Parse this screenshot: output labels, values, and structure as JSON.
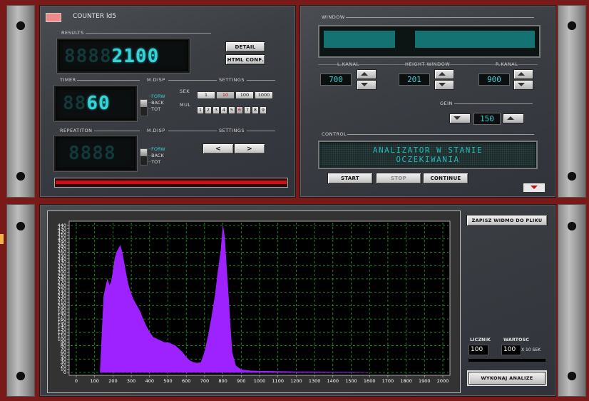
{
  "app": {
    "title": "COUNTER ld5"
  },
  "results": {
    "label": "RESULTS",
    "value": "2100",
    "ghost": "8888",
    "detail_label": "DETAIL",
    "html_label": "HTML CONF."
  },
  "timer": {
    "label": "TIMER",
    "value": "60",
    "ghost": "88",
    "mdisp_label": "M.DISP",
    "settings_label": "SETTINGS",
    "options": [
      "FORW",
      "BACK",
      "TOT"
    ],
    "sek_label": "SEK",
    "mul_label": "MUL",
    "sek_values": [
      "1",
      "10",
      "100",
      "1000"
    ],
    "sek_selected": "10",
    "mul_values": [
      "1",
      "2",
      "3",
      "4",
      "5",
      "6",
      "7",
      "8",
      "9"
    ],
    "mul_selected": "6"
  },
  "repetition": {
    "label": "REPEATITON",
    "ghost": "8888",
    "mdisp_label": "M.DISP",
    "settings_label": "SETTINGS",
    "options": [
      "FORW",
      "BACK",
      "TOT"
    ],
    "prev_label": "<",
    "next_label": ">"
  },
  "window": {
    "label": "WINDOW",
    "lkanal_label": "L.KANAL",
    "lkanal_value": "700",
    "height_label": "HEIGHT WINDOW",
    "height_value": "201",
    "rkanal_label": "R.KANAL",
    "rkanal_value": "900",
    "gein_label": "GEIN",
    "gein_value": "150"
  },
  "control": {
    "label": "CONTROL",
    "message_line1": "ANALIZATOR W STANIE",
    "message_line2": "OCZEKIWANIA",
    "start_label": "START",
    "stop_label": "STOP",
    "continue_label": "CONTINUE"
  },
  "spectrum_panel": {
    "save_label": "ZAPISZ WIDMO DO PLIKU",
    "licznik_label": "LICZNIK",
    "licznik_value": "100",
    "wartosc_label": "WARTOSC",
    "wartosc_value": "100",
    "wartosc_unit": "X 10 SEK",
    "analyze_label": "WYKONAJ ANALIZE"
  },
  "colors": {
    "lcd": "#37d3d6",
    "spectrum": "#9d22ff",
    "grid": "#22aa22",
    "chassis": "#7a1a18"
  },
  "chart_data": {
    "type": "area",
    "xlim": [
      0,
      2000
    ],
    "ylim": [
      0,
      440
    ],
    "xticks": [
      0,
      100,
      200,
      300,
      400,
      500,
      600,
      700,
      800,
      900,
      1000,
      1100,
      1200,
      1300,
      1400,
      1500,
      1600,
      1700,
      1800,
      1900,
      2000
    ],
    "yticks": [
      0,
      10,
      20,
      30,
      40,
      50,
      60,
      70,
      80,
      90,
      100,
      110,
      120,
      130,
      140,
      150,
      160,
      170,
      180,
      190,
      200,
      210,
      220,
      230,
      240,
      250,
      260,
      270,
      280,
      290,
      300,
      310,
      320,
      330,
      340,
      350,
      360,
      370,
      380,
      390,
      400,
      410,
      420,
      430,
      440
    ],
    "grid": true,
    "x": [
      130,
      150,
      170,
      180,
      190,
      200,
      210,
      220,
      230,
      240,
      250,
      260,
      270,
      280,
      290,
      300,
      310,
      320,
      330,
      340,
      350,
      360,
      380,
      400,
      420,
      440,
      460,
      480,
      500,
      520,
      540,
      560,
      580,
      600,
      620,
      640,
      660,
      680,
      700,
      720,
      740,
      760,
      770,
      780,
      790,
      800,
      810,
      820,
      830,
      840,
      850,
      870,
      900,
      950,
      1000,
      1100,
      1200,
      1300,
      1400,
      1500,
      1600
    ],
    "y": [
      0,
      230,
      280,
      260,
      270,
      300,
      340,
      360,
      370,
      380,
      360,
      330,
      300,
      270,
      250,
      235,
      220,
      210,
      200,
      190,
      180,
      165,
      140,
      120,
      105,
      100,
      95,
      90,
      90,
      85,
      80,
      70,
      60,
      45,
      35,
      30,
      28,
      30,
      60,
      110,
      170,
      240,
      290,
      330,
      370,
      440,
      400,
      310,
      230,
      140,
      60,
      20,
      8,
      5,
      4,
      3,
      2,
      2,
      1,
      1,
      0
    ],
    "xlabel": "",
    "ylabel": ""
  }
}
